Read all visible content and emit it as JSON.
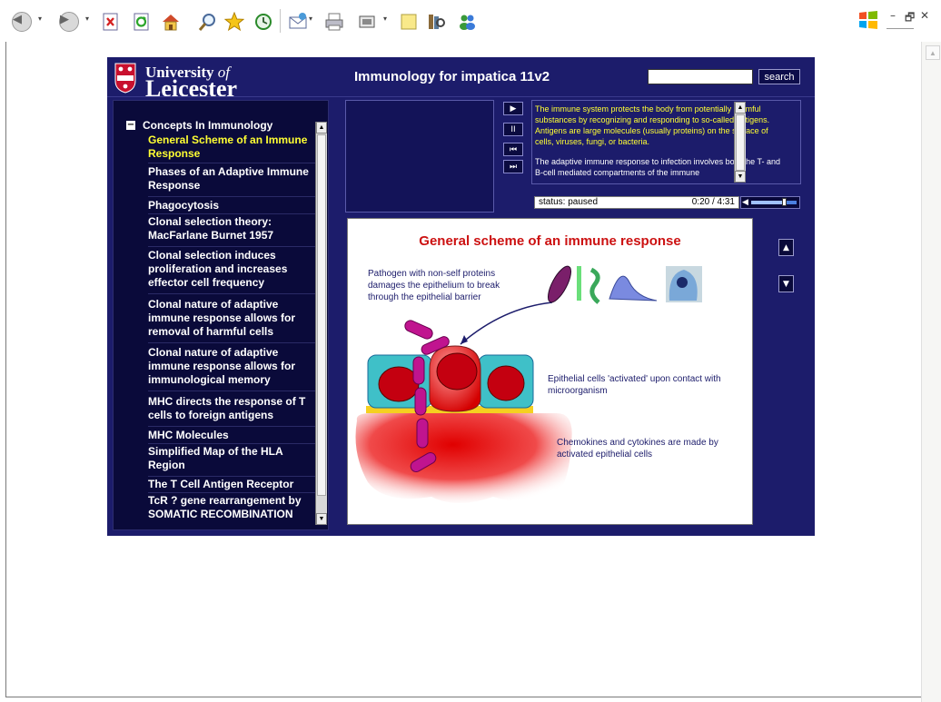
{
  "app": {
    "logo_line1_prefix": "University ",
    "logo_line1_of": "of",
    "logo_line2": "Leicester",
    "title": "Immunology for impatica 11v2"
  },
  "search": {
    "value": "",
    "button_label": "search"
  },
  "sidebar": {
    "section_title": "Concepts In Immunology",
    "collapse_symbol": "−",
    "items": [
      {
        "label": "General Scheme of an Immune Response",
        "active": true
      },
      {
        "label": "Phases of an Adaptive Immune Response"
      },
      {
        "label": "Phagocytosis"
      },
      {
        "label": "Clonal selection theory: MacFarlane Burnet 1957"
      },
      {
        "label": "Clonal selection induces proliferation and increases effector cell frequency"
      },
      {
        "label": "Clonal nature of adaptive immune response allows for removal of harmful cells"
      },
      {
        "label": "Clonal nature of adaptive immune response allows for immunological memory"
      },
      {
        "label": "MHC directs the response of T cells to foreign antigens"
      },
      {
        "label": "MHC Molecules"
      },
      {
        "label": "Simplified Map of the HLA Region"
      },
      {
        "label": "The T Cell Antigen Receptor"
      },
      {
        "label": "TcR ? gene rearrangement by SOMATIC RECOMBINATION"
      }
    ]
  },
  "player": {
    "controls": {
      "play": "▶",
      "pause": "II",
      "rewind": "⏮",
      "forward": "⏭"
    },
    "status": "status: paused",
    "time": "0:20 / 4:31",
    "volume_level": 0.72
  },
  "transcript": {
    "p1": "The immune system protects the body from potentially harmful substances by recognizing and responding to so-called antigens. Antigens are large molecules (usually proteins) on the surface of cells, viruses, fungi, or bacteria.",
    "p2": "The adaptive immune response to infection involves both the T- and B-cell mediated compartments of the immune"
  },
  "slide": {
    "title": "General scheme of an immune response",
    "label_pathogen": "Pathogen with non-self proteins damages the epithelium to break through the epithelial barrier",
    "label_epithelial": "Epithelial cells 'activated' upon contact with microorganism",
    "label_chemokines": "Chemokines and cytokines are made by activated epithelial cells",
    "nav_up": "▲",
    "nav_down": "▼"
  },
  "browser": {
    "icons": [
      "back-icon",
      "forward-icon",
      "stop-icon",
      "refresh-icon",
      "home-icon",
      "search-icon",
      "favorites-icon",
      "history-icon",
      "mail-icon",
      "print-icon",
      "edit-icon",
      "notes-icon",
      "research-icon",
      "messenger-icon"
    ],
    "window_controls": {
      "minimize": "–",
      "restore": "🗗",
      "close": "✕"
    }
  },
  "colors": {
    "app_background": "#1c1c6b",
    "active_nav": "#ffff33",
    "slide_title": "#cc1111",
    "pathogen": "#c0148f",
    "epithelial": "#3fc0c8",
    "cell_red": "#c40010"
  }
}
